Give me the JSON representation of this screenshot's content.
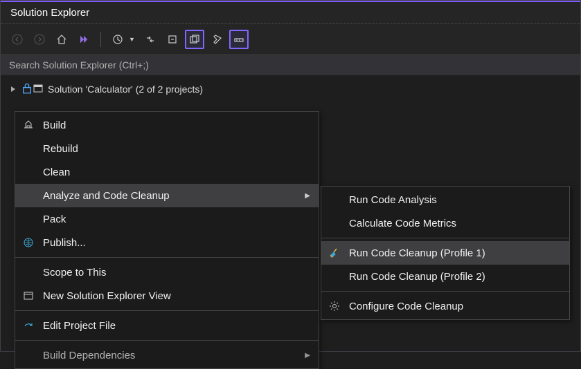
{
  "title": "Solution Explorer",
  "search": {
    "placeholder": "Search Solution Explorer (Ctrl+;)"
  },
  "tree": {
    "solution_label": "Solution 'Calculator' (2 of 2 projects)"
  },
  "context_menu": {
    "build": "Build",
    "rebuild": "Rebuild",
    "clean": "Clean",
    "analyze": "Analyze and Code Cleanup",
    "pack": "Pack",
    "publish": "Publish...",
    "scope": "Scope to This",
    "new_view": "New Solution Explorer View",
    "edit_project": "Edit Project File",
    "build_deps": "Build Dependencies"
  },
  "submenu": {
    "run_analysis": "Run Code Analysis",
    "calc_metrics": "Calculate Code Metrics",
    "cleanup1": "Run Code Cleanup (Profile 1)",
    "cleanup2": "Run Code Cleanup (Profile 2)",
    "configure": "Configure Code Cleanup"
  }
}
